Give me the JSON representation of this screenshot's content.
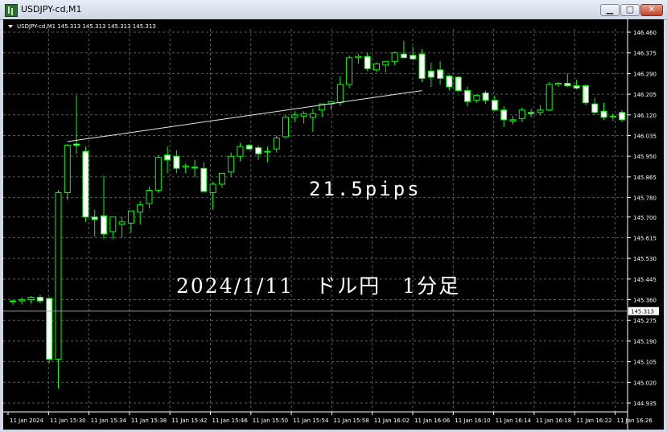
{
  "window": {
    "title": "USDJPY-cd,M1",
    "buttons": {
      "minimize": "▁",
      "maximize": "▢",
      "close": "✕"
    }
  },
  "chart_data": {
    "type": "candlestick",
    "header": "USDJPY-cd,M1  145.313 145.313 145.313 145.313",
    "current_price_label": "145.313",
    "current_price": 145.313,
    "ylim": [
      144.935,
      146.47
    ],
    "y_ticks": [
      "146.460",
      "146.375",
      "146.290",
      "146.205",
      "146.120",
      "146.035",
      "145.950",
      "145.865",
      "145.780",
      "145.700",
      "145.615",
      "145.530",
      "145.445",
      "145.360",
      "145.275",
      "145.190",
      "145.105",
      "145.020",
      "144.935"
    ],
    "x_ticks": [
      "11 Jan 2024",
      "11 Jan 15:30",
      "11 Jan 15:34",
      "11 Jan 15:38",
      "11 Jan 15:42",
      "11 Jan 15:46",
      "11 Jan 15:50",
      "11 Jan 15:54",
      "11 Jan 15:58",
      "11 Jan 16:02",
      "11 Jan 16:06",
      "11 Jan 16:10",
      "11 Jan 16:14",
      "11 Jan 16:18",
      "11 Jan 16:22",
      "11 Jan 16:26"
    ],
    "annotations": [
      "21.5pips",
      "2024/1/11　ドル円　1分足"
    ],
    "trendline": {
      "from": {
        "bar": 6,
        "price": 146.01
      },
      "to": {
        "bar": 45,
        "price": 146.22
      }
    },
    "candles": [
      [
        145.355,
        145.36,
        145.34,
        145.355
      ],
      [
        145.355,
        145.37,
        145.34,
        145.36
      ],
      [
        145.36,
        145.375,
        145.345,
        145.37
      ],
      [
        145.37,
        145.38,
        145.345,
        145.355
      ],
      [
        145.365,
        145.37,
        145.1,
        145.115
      ],
      [
        145.115,
        145.81,
        144.995,
        145.8
      ],
      [
        145.8,
        146.0,
        145.77,
        145.995
      ],
      [
        146.0,
        146.2,
        145.96,
        145.995
      ],
      [
        145.97,
        145.99,
        145.68,
        145.7
      ],
      [
        145.7,
        145.73,
        145.62,
        145.69
      ],
      [
        145.705,
        145.87,
        145.61,
        145.63
      ],
      [
        145.64,
        145.68,
        145.61,
        145.7
      ],
      [
        145.67,
        145.7,
        145.615,
        145.68
      ],
      [
        145.675,
        145.725,
        145.635,
        145.725
      ],
      [
        145.72,
        145.765,
        145.67,
        145.75
      ],
      [
        145.755,
        145.825,
        145.735,
        145.81
      ],
      [
        145.81,
        145.955,
        145.8,
        145.945
      ],
      [
        145.955,
        145.99,
        145.88,
        145.935
      ],
      [
        145.95,
        145.975,
        145.88,
        145.9
      ],
      [
        145.905,
        145.92,
        145.88,
        145.91
      ],
      [
        145.905,
        145.935,
        145.865,
        145.905
      ],
      [
        145.9,
        145.925,
        145.81,
        145.805
      ],
      [
        145.8,
        145.845,
        145.73,
        145.835
      ],
      [
        145.835,
        145.88,
        145.82,
        145.88
      ],
      [
        145.885,
        145.965,
        145.865,
        145.95
      ],
      [
        145.95,
        146.005,
        145.93,
        145.99
      ],
      [
        145.995,
        146.0,
        145.975,
        145.98
      ],
      [
        145.985,
        145.995,
        145.935,
        145.96
      ],
      [
        145.97,
        145.99,
        145.925,
        145.97
      ],
      [
        145.98,
        146.035,
        145.965,
        146.025
      ],
      [
        146.03,
        146.12,
        146.025,
        146.11
      ],
      [
        146.11,
        146.135,
        146.09,
        146.12
      ],
      [
        146.115,
        146.135,
        146.085,
        146.125
      ],
      [
        146.11,
        146.145,
        146.05,
        146.125
      ],
      [
        146.14,
        146.165,
        146.11,
        146.165
      ],
      [
        146.165,
        146.175,
        146.14,
        146.175
      ],
      [
        146.17,
        146.28,
        146.16,
        146.245
      ],
      [
        146.245,
        146.365,
        146.23,
        146.355
      ],
      [
        146.355,
        146.37,
        146.33,
        146.36
      ],
      [
        146.36,
        146.375,
        146.3,
        146.31
      ],
      [
        146.305,
        146.335,
        146.295,
        146.33
      ],
      [
        146.325,
        146.34,
        146.295,
        146.34
      ],
      [
        146.34,
        146.38,
        146.325,
        146.375
      ],
      [
        146.37,
        146.425,
        146.355,
        146.355
      ],
      [
        146.365,
        146.4,
        146.345,
        146.35
      ],
      [
        146.37,
        146.39,
        146.255,
        146.27
      ],
      [
        146.3,
        146.335,
        146.235,
        146.275
      ],
      [
        146.305,
        146.34,
        146.245,
        146.27
      ],
      [
        146.28,
        146.285,
        146.22,
        146.235
      ],
      [
        146.275,
        146.28,
        146.215,
        146.22
      ],
      [
        146.22,
        146.235,
        146.155,
        146.175
      ],
      [
        146.18,
        146.205,
        146.17,
        146.2
      ],
      [
        146.21,
        146.22,
        146.165,
        146.18
      ],
      [
        146.18,
        146.2,
        146.135,
        146.14
      ],
      [
        146.14,
        146.155,
        146.07,
        146.1
      ],
      [
        146.095,
        146.115,
        146.08,
        146.1
      ],
      [
        146.105,
        146.15,
        146.09,
        146.14
      ],
      [
        146.13,
        146.145,
        146.11,
        146.125
      ],
      [
        146.13,
        146.16,
        146.12,
        146.14
      ],
      [
        146.14,
        146.255,
        146.135,
        146.245
      ],
      [
        146.245,
        146.255,
        146.235,
        146.25
      ],
      [
        146.25,
        146.29,
        146.235,
        146.24
      ],
      [
        146.24,
        146.265,
        146.225,
        146.23
      ],
      [
        146.24,
        146.245,
        146.16,
        146.17
      ],
      [
        146.165,
        146.19,
        146.12,
        146.13
      ],
      [
        146.135,
        146.17,
        146.1,
        146.11
      ],
      [
        146.115,
        146.125,
        146.095,
        146.115
      ],
      [
        146.13,
        146.14,
        146.09,
        146.1
      ]
    ]
  }
}
